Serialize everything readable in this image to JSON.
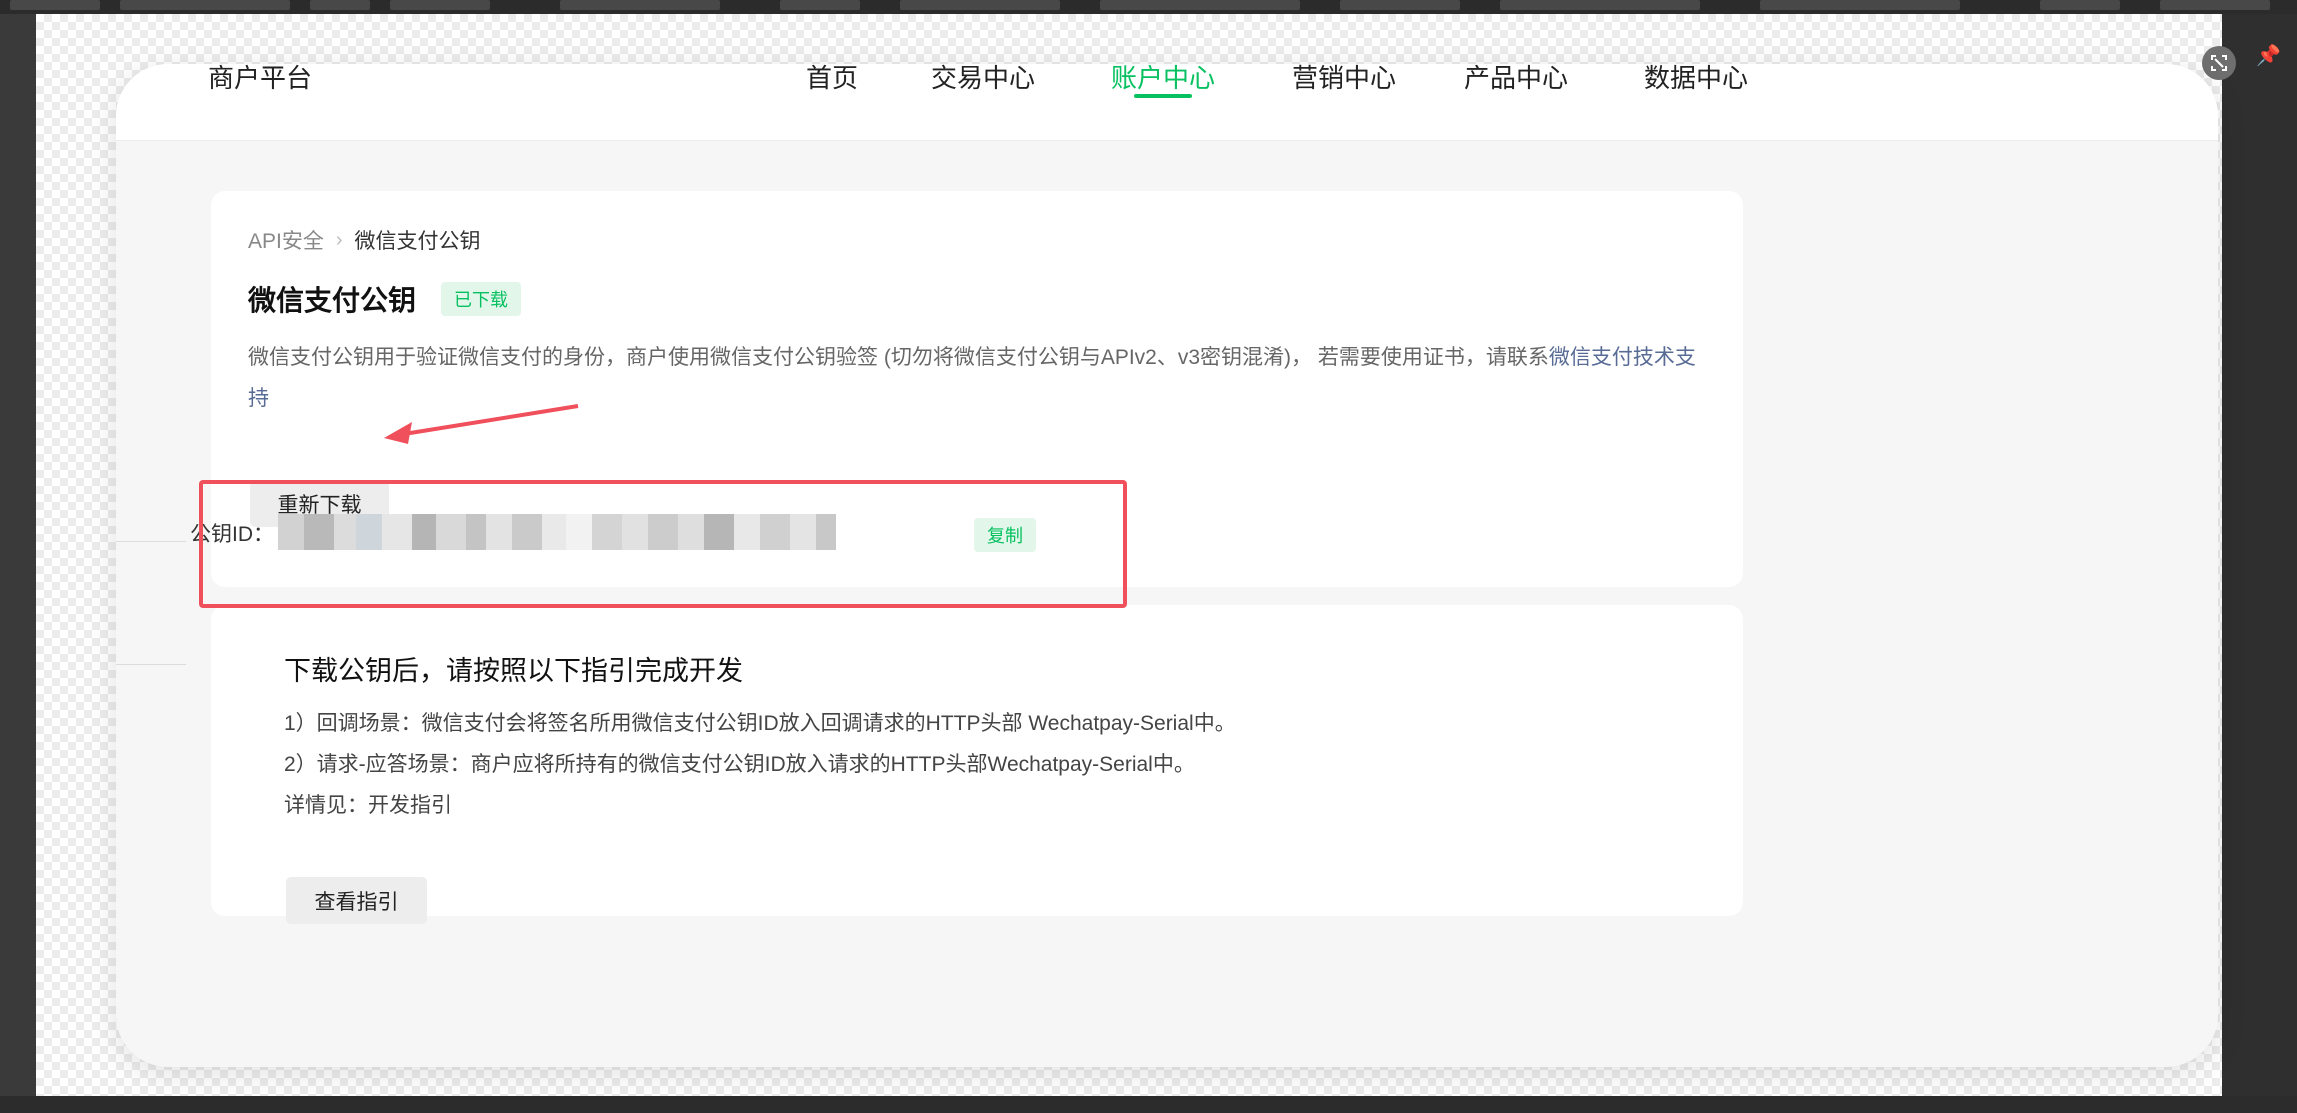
{
  "nav": {
    "brand": "商户平台",
    "items": [
      {
        "label": "首页",
        "active": false
      },
      {
        "label": "交易中心",
        "active": false
      },
      {
        "label": "账户中心",
        "active": true
      },
      {
        "label": "营销中心",
        "active": false
      },
      {
        "label": "产品中心",
        "active": false
      },
      {
        "label": "数据中心",
        "active": false
      }
    ]
  },
  "breadcrumb": {
    "parent": "API安全",
    "current": "微信支付公钥"
  },
  "key_card": {
    "title": "微信支付公钥",
    "status_badge": "已下载",
    "description_prefix": "微信支付公钥用于验证微信支付的身份，商户使用微信支付公钥验签 (切勿将微信支付公钥与APIv2、v3密钥混淆)， 若需要使用证书，请联系",
    "support_link": "微信支付技术支持",
    "redownload_label": "重新下载",
    "pubkey_label": "公钥ID：",
    "copy_label": "复制"
  },
  "guide_card": {
    "title": "下载公钥后，请按照以下指引完成开发",
    "line1": "1）回调场景：微信支付会将签名所用微信支付公钥ID放入回调请求的HTTP头部 Wechatpay-Serial中。",
    "line2": "2）请求-应答场景：商户应将所持有的微信支付公钥ID放入请求的HTTP头部Wechatpay-Serial中。",
    "line3": "详情见：开发指引",
    "view_label": "查看指引"
  },
  "colors": {
    "accent": "#07c160",
    "link": "#576b95",
    "annotation": "#f0505c"
  },
  "icons": [
    "expand-icon",
    "pin-icon",
    "chevron-right-icon",
    "annotation-arrow"
  ]
}
